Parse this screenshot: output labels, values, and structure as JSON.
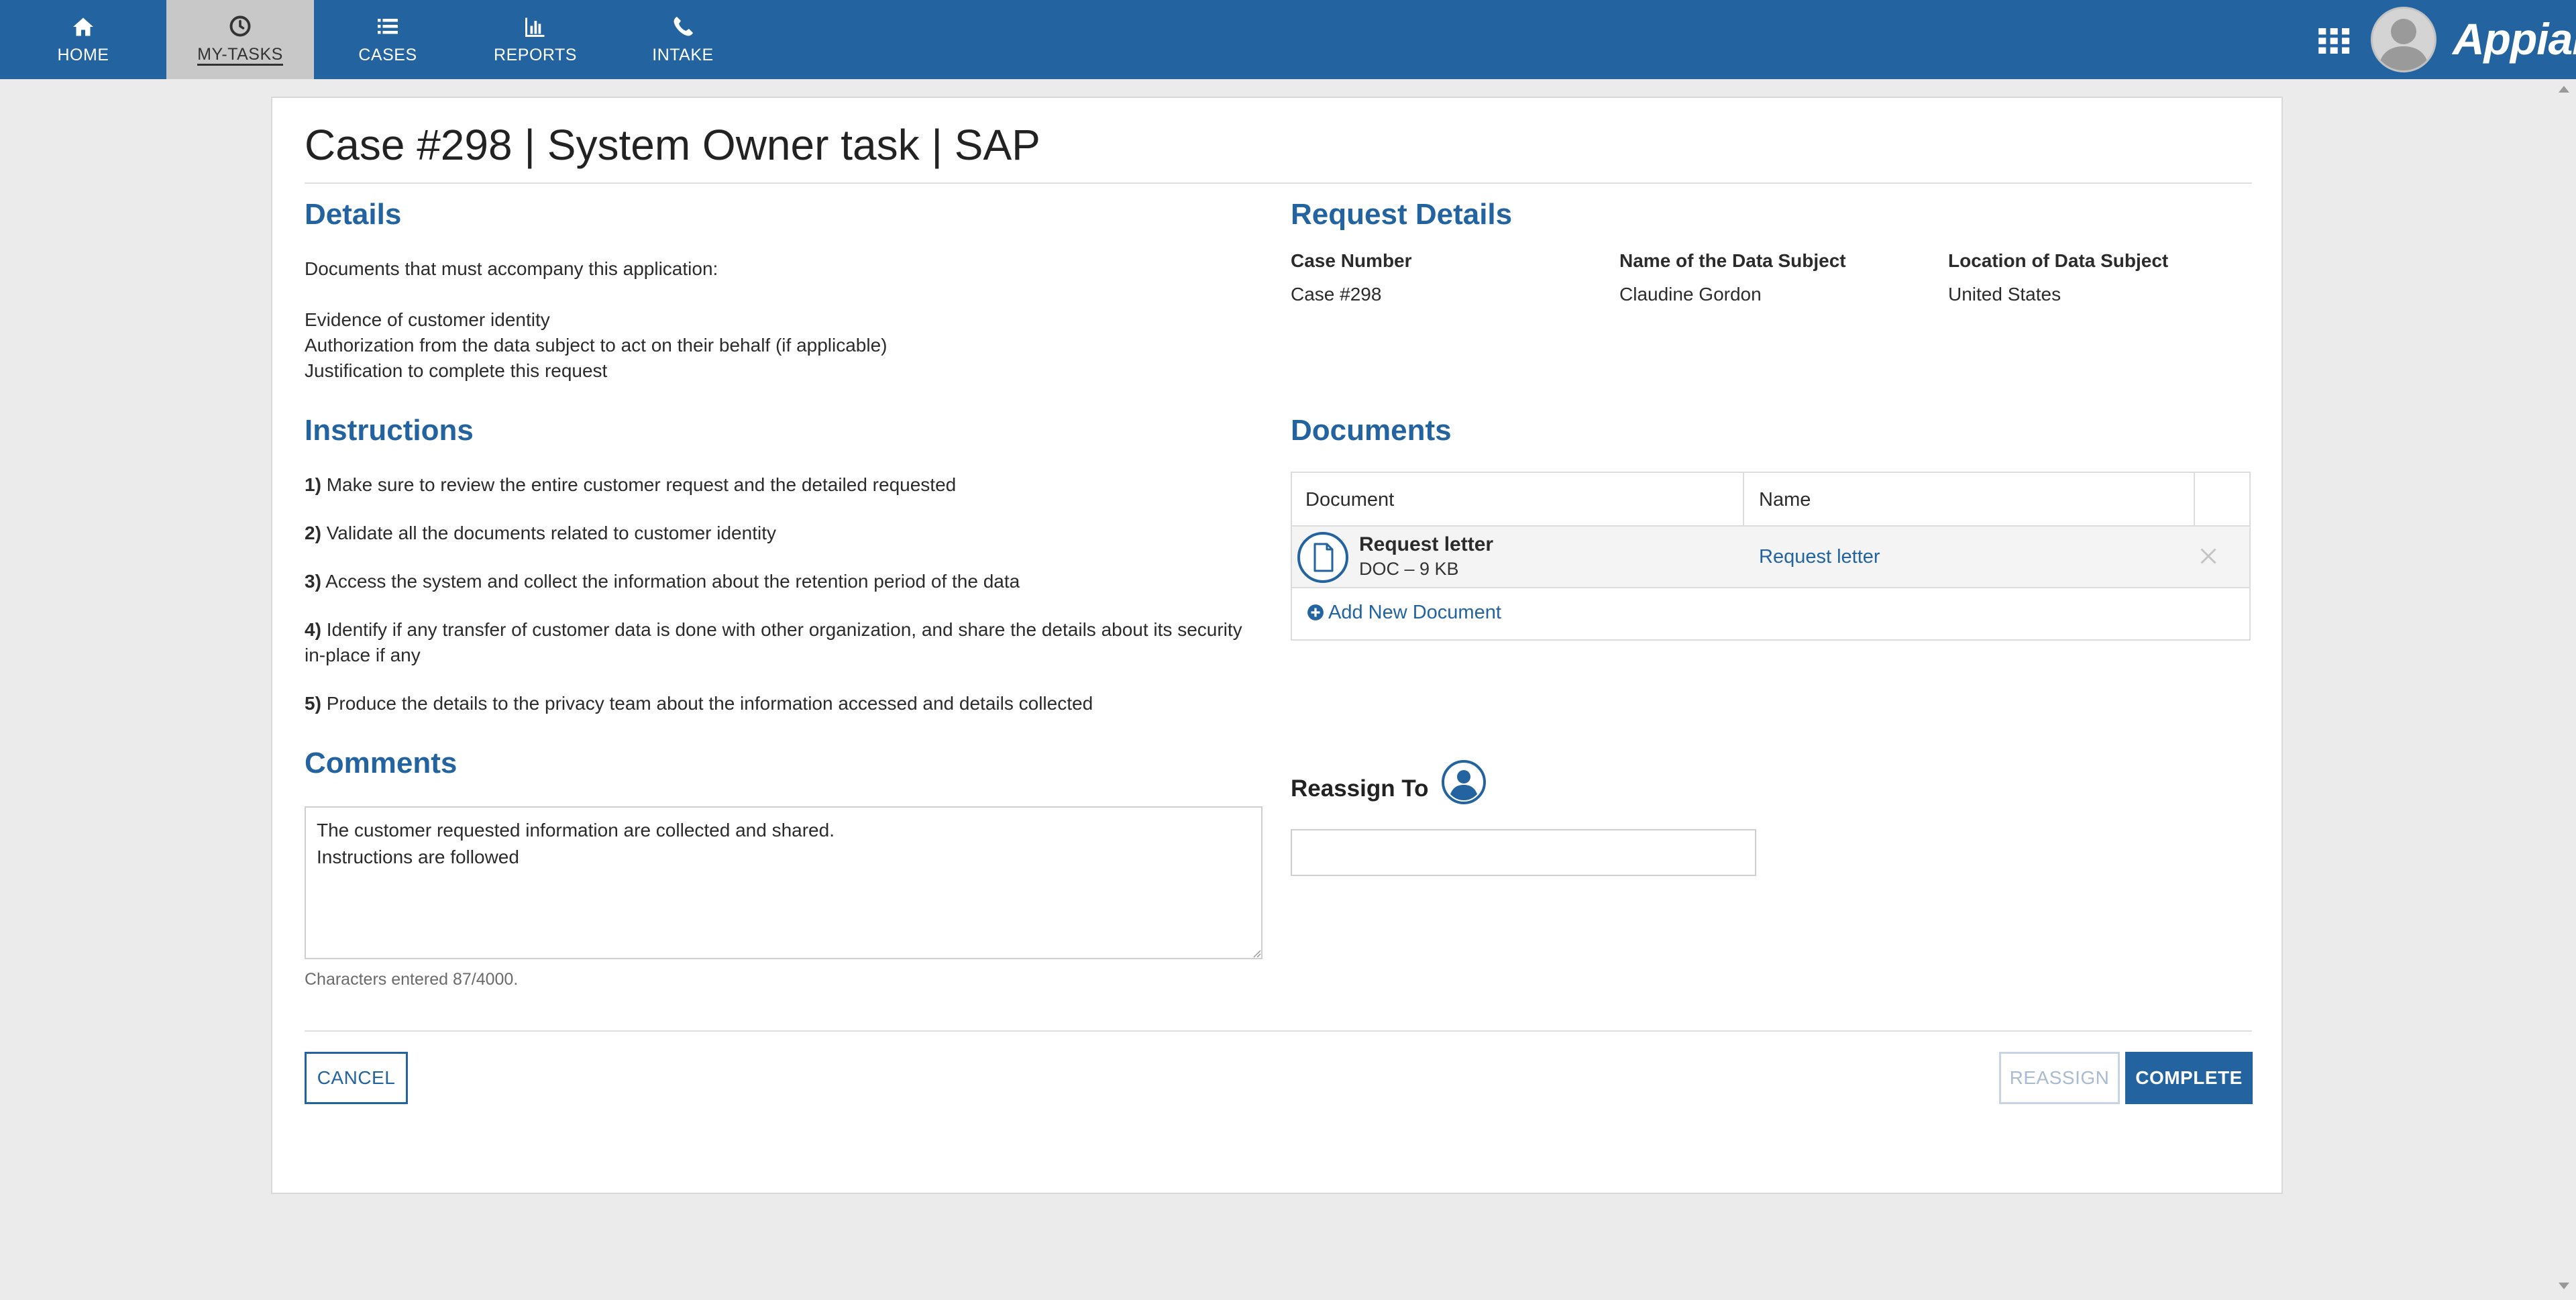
{
  "nav": {
    "items": [
      {
        "label": "HOME",
        "icon": "home-icon"
      },
      {
        "label": "MY-TASKS",
        "icon": "clock-icon",
        "active": true
      },
      {
        "label": "CASES",
        "icon": "list-icon"
      },
      {
        "label": "REPORTS",
        "icon": "bar-chart-icon"
      },
      {
        "label": "INTAKE",
        "icon": "phone-icon"
      }
    ],
    "apps_icon": "grid-icon",
    "user_icon": "user-avatar-icon",
    "brand": "Appian"
  },
  "page": {
    "title": "Case #298 | System Owner task | SAP"
  },
  "details": {
    "heading": "Details",
    "intro": "Documents that must accompany this application:",
    "items": [
      "Evidence of customer identity",
      "Authorization from the data subject to act on their behalf (if applicable)",
      "Justification to complete this request"
    ]
  },
  "instructions": {
    "heading": "Instructions",
    "steps": [
      {
        "num": "1)",
        "text": "Make sure to review the entire customer request and the detailed requested"
      },
      {
        "num": "2)",
        "text": "Validate all the documents related to customer identity"
      },
      {
        "num": "3)",
        "text": "Access the system and collect the information about the retention period of the data"
      },
      {
        "num": "4)",
        "text": "Identify if any transfer of customer data is done with other organization, and share the details about its security in-place if any"
      },
      {
        "num": "5)",
        "text": "Produce the details to the privacy team about the information accessed and details collected"
      }
    ]
  },
  "comments": {
    "heading": "Comments",
    "value": "The customer requested information are collected and shared.\nInstructions are followed",
    "char_count": "Characters entered 87/4000."
  },
  "request_details": {
    "heading": "Request Details",
    "fields": [
      {
        "label": "Case Number",
        "value": "Case #298"
      },
      {
        "label": "Name of the Data Subject",
        "value": "Claudine Gordon"
      },
      {
        "label": "Location of Data Subject",
        "value": "United States"
      }
    ]
  },
  "documents": {
    "heading": "Documents",
    "columns": [
      "Document",
      "Name"
    ],
    "rows": [
      {
        "file_name": "Request letter",
        "file_meta": "DOC – 9 KB",
        "name": "Request letter",
        "icon": "document-icon"
      }
    ],
    "add_label": "Add New Document"
  },
  "reassign": {
    "label": "Reassign To",
    "icon": "user-circle-icon",
    "value": ""
  },
  "buttons": {
    "cancel": "CANCEL",
    "reassign": "REASSIGN",
    "complete": "COMPLETE"
  },
  "colors": {
    "primary": "#2263a0",
    "background": "#ebebeb",
    "disabled": "#a8bbd0"
  }
}
